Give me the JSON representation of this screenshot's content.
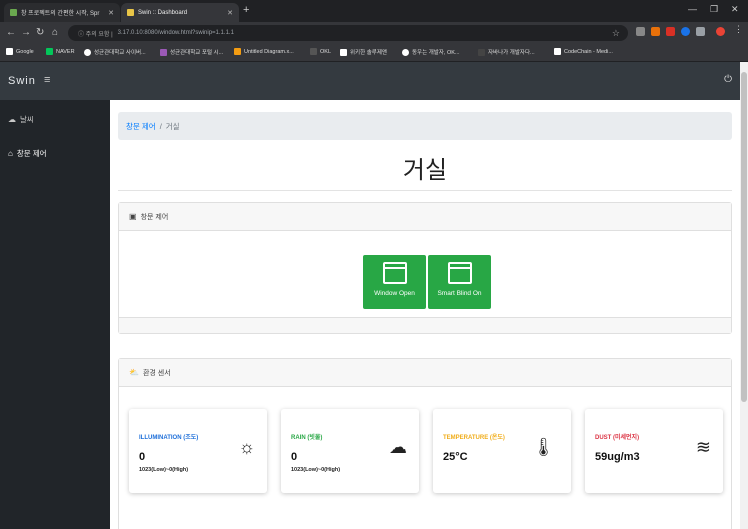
{
  "browser": {
    "tabs": [
      {
        "title": "창 프로젝트의 간편한 시작, Spr",
        "active": false
      },
      {
        "title": "Swin :: Dashboard",
        "active": true
      }
    ],
    "address": {
      "secure_label": "주의 요함",
      "url": "3.17.0.10:8080/window.html?swinip=1.1.1.1"
    },
    "bookmarks": [
      "Google",
      "NAVER",
      "성균관대학교 사이버...",
      "성균관대학교 포털 시...",
      "Untitled Diagram.x...",
      "OKL",
      "위키한 솔루제앤",
      "동우는 개발자, OK...",
      "자바나가 개발자다...",
      "CodeChain - Medi..."
    ]
  },
  "app": {
    "brand": "Swin",
    "sidebar": {
      "items": [
        {
          "label": "날씨",
          "icon": "cloud-icon"
        },
        {
          "label": "창문 제어",
          "icon": "home-icon"
        }
      ]
    },
    "breadcrumb": {
      "parent": "창문 제어",
      "current": "거실"
    },
    "page_title": "거실",
    "control_card": {
      "title": "창문 제어",
      "buttons": [
        {
          "label": "Window Open"
        },
        {
          "label": "Smart Blind On"
        }
      ]
    },
    "sensor_card": {
      "title": "환경 센서",
      "sensors": [
        {
          "label": "ILLUMINATION (조도)",
          "value": "0",
          "range": "1023(Low)~0(High)",
          "color": "#1e6fd9",
          "icon": "sun-icon"
        },
        {
          "label": "RAIN (빗물)",
          "value": "0",
          "range": "1023(Low)~0(High)",
          "color": "#28a745",
          "icon": "rain-cloud-icon"
        },
        {
          "label": "TEMPERATURE (온도)",
          "value": "25°C",
          "range": "",
          "color": "#f0ad1a",
          "icon": "thermometer-icon"
        },
        {
          "label": "DUST (미세먼지)",
          "value": "59ug/m3",
          "range": "",
          "color": "#dc3545",
          "icon": "wind-icon"
        }
      ]
    }
  }
}
